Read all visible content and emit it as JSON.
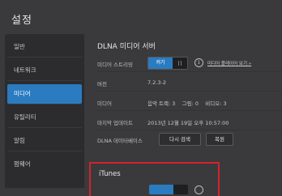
{
  "app": {
    "title": "설정"
  },
  "sidebar": {
    "items": [
      {
        "label": "일반"
      },
      {
        "label": "네트워크"
      },
      {
        "label": "미디어"
      },
      {
        "label": "유틸리티"
      },
      {
        "label": "알림"
      },
      {
        "label": "펌웨어"
      }
    ],
    "active_index": 2
  },
  "dlna": {
    "title": "DLNA 미디어 서버",
    "streaming": {
      "label": "미디어 스트리밍",
      "toggle_on_label": "켜기",
      "link": "미디어 플레이어 보기 »"
    },
    "version": {
      "label": "버전",
      "value": "7.2.3-2"
    },
    "media": {
      "label": "미디어",
      "value": "음악 트랙: 3    그림: 0    비디오: 3"
    },
    "last_update": {
      "label": "마지막 업데이트",
      "value": "2013년 12월 19일 오후 10:57:00"
    },
    "database": {
      "label": "DLNA 데이터베이스",
      "rescan_button": "다시 검색",
      "restore_button": "복원"
    }
  },
  "itunes": {
    "title": "iTunes"
  },
  "colors": {
    "accent": "#2a7bc0",
    "highlight_border": "#d2232a",
    "background": "#3a3a3d"
  }
}
